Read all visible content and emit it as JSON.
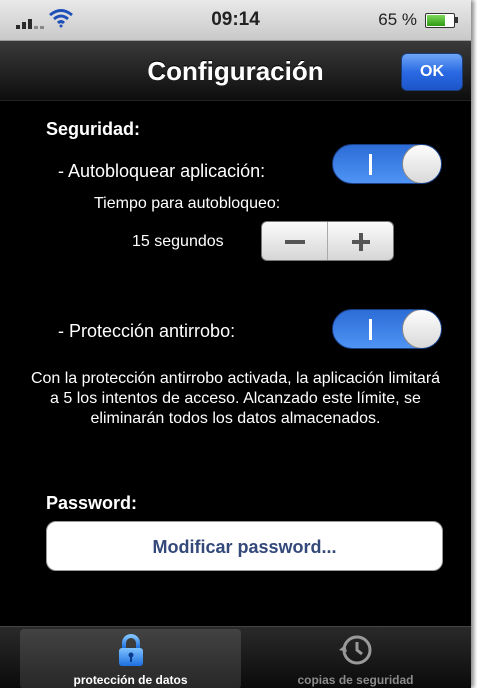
{
  "status_bar": {
    "time": "09:14",
    "battery_percent": "65 %",
    "battery_level": 0.65,
    "signal_icon": "signal-bars-icon",
    "wifi_icon": "wifi-icon",
    "battery_icon": "battery-icon"
  },
  "nav": {
    "title": "Configuración",
    "ok_label": "OK"
  },
  "security": {
    "heading": "Seguridad:",
    "autolock_label": "- Autobloquear aplicación:",
    "autolock_on": true,
    "autolock_time_label": "Tiempo para autobloqueo:",
    "autolock_time_value": "15 segundos",
    "antitheft_label": "- Protección antirrobo:",
    "antitheft_on": true,
    "antitheft_info": "Con la protección antirrobo activada, la aplicación limitará a 5 los intentos de acceso. Alcanzado este límite, se eliminarán todos los datos almacenados."
  },
  "password": {
    "heading": "Password:",
    "modify_label": "Modificar password..."
  },
  "tabs": [
    {
      "label": "protección de datos",
      "icon": "lock-icon",
      "active": true
    },
    {
      "label": "copias de seguridad",
      "icon": "history-clock-icon",
      "active": false
    }
  ],
  "colors": {
    "accent_blue": "#2a6ae3",
    "button_text": "#33497a"
  }
}
